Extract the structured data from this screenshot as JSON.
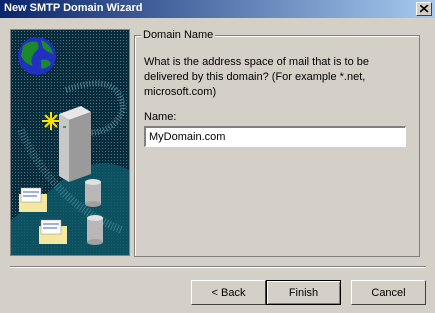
{
  "window": {
    "title": "New SMTP Domain Wizard",
    "close_icon": "close-icon"
  },
  "group": {
    "legend": "Domain Name",
    "description": "What is the address space of mail that is to be delivered by this domain? (For example *.net, microsoft.com)",
    "name_label": "Name:",
    "name_value": "MyDomain.com"
  },
  "buttons": {
    "back": "< Back",
    "finish": "Finish",
    "cancel": "Cancel"
  },
  "artwork": {
    "icons": [
      "globe-icon",
      "server-icon",
      "spark-icon",
      "envelope-icon",
      "database-icon"
    ],
    "colors": {
      "background": "#0b2b3a",
      "accent": "#00a0a0",
      "globe_land": "#1a8a2a",
      "globe_sea": "#2030c0"
    }
  }
}
